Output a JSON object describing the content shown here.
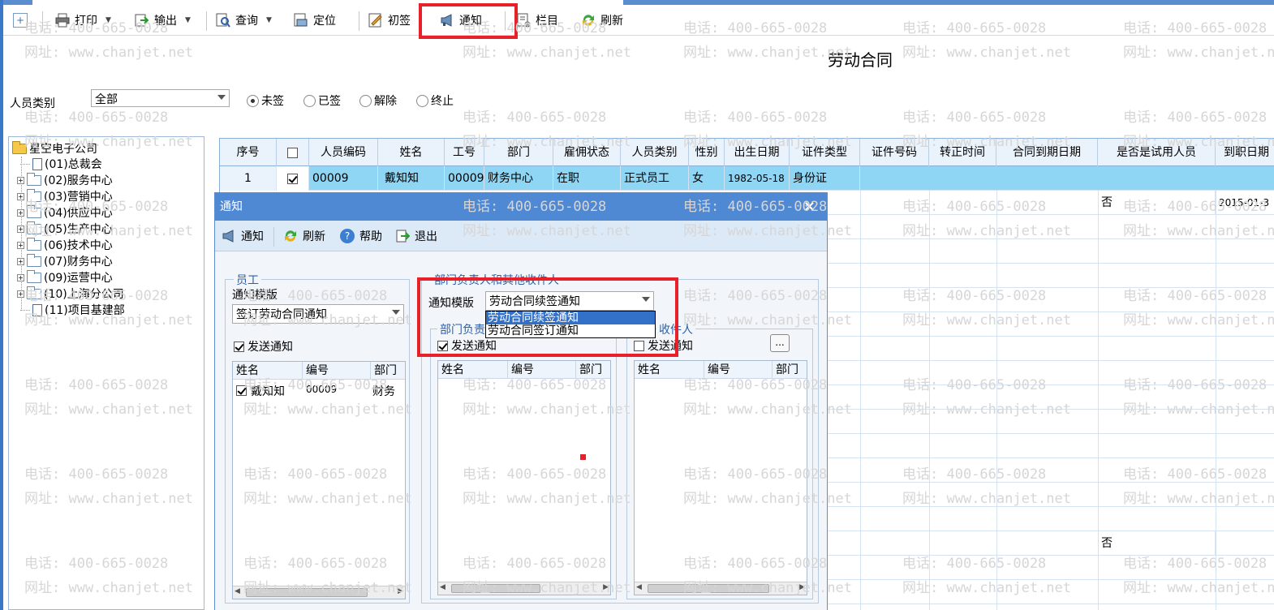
{
  "toolbar": {
    "print": "打印",
    "export": "输出",
    "query": "查询",
    "locate": "定位",
    "initial_sign": "初签",
    "notify": "通知",
    "columns": "栏目",
    "refresh": "刷新"
  },
  "page_title": "劳动合同",
  "filter": {
    "person_type_label": "人员类别",
    "person_type_value": "全部",
    "status_options": [
      "未签",
      "已签",
      "解除",
      "终止"
    ],
    "selected_status": "未签"
  },
  "tree": {
    "root": "星空电子公司",
    "children": [
      {
        "label": "(01)总裁会",
        "expandable": false
      },
      {
        "label": "(02)服务中心",
        "expandable": true
      },
      {
        "label": "(03)营销中心",
        "expandable": true
      },
      {
        "label": "(04)供应中心",
        "expandable": true
      },
      {
        "label": "(05)生产中心",
        "expandable": true
      },
      {
        "label": "(06)技术中心",
        "expandable": true
      },
      {
        "label": "(07)财务中心",
        "expandable": true
      },
      {
        "label": "(09)运营中心",
        "expandable": true
      },
      {
        "label": "(10)上海分公司",
        "expandable": true
      },
      {
        "label": "(11)项目基建部",
        "expandable": false
      }
    ]
  },
  "grid": {
    "columns": [
      "序号",
      "",
      "人员编码",
      "姓名",
      "工号",
      "部门",
      "雇佣状态",
      "人员类别",
      "性别",
      "出生日期",
      "证件类型",
      "证件号码",
      "转正时间",
      "合同到期日期",
      "是否是试用人员",
      "到职日期"
    ],
    "row1": {
      "seq": "1",
      "checked": true,
      "code": "00009",
      "name": "戴知知",
      "job_no": "00009",
      "dept": "财务中心",
      "employ_status": "在职",
      "person_type": "正式员工",
      "gender": "女",
      "birth_date": "1982-05-18",
      "id_type": "身份证"
    },
    "row2": {
      "trial": "否",
      "join_date": "2015-01-3"
    },
    "row_bottom": {
      "trial": "否"
    }
  },
  "dialog": {
    "title": "通知",
    "close": "×",
    "toolbar": {
      "notify": "通知",
      "refresh": "刷新",
      "help": "帮助",
      "exit": "退出"
    },
    "employee_group": {
      "title": "员工",
      "template_label": "通知模版",
      "template_value": "签订劳动合同通知",
      "send_label": "发送通知",
      "send_checked": true,
      "list_headers": [
        "姓名",
        "编号",
        "部门"
      ],
      "rows": [
        {
          "checked": true,
          "name": "戴知知",
          "code": "00009",
          "dept": "财务"
        }
      ]
    },
    "manager_group": {
      "title": "部门负责人和其他收件人",
      "template_label": "通知模版",
      "template_value": "劳动合同续签通知",
      "dropdown_options": [
        "劳动合同续签通知",
        "劳动合同签订通知"
      ],
      "dept_head_title": "部门负责",
      "dept_head_send_label": "发送通知",
      "dept_head_send_checked": true,
      "dept_head_headers": [
        "姓名",
        "编号",
        "部门"
      ],
      "other_title": "收件人",
      "other_send_label": "发送通知",
      "other_send_checked": false,
      "other_more": "...",
      "other_headers": [
        "姓名",
        "编号",
        "部门"
      ]
    }
  },
  "watermark": {
    "phone": "电话: 400-665-0028",
    "site": "网址: www.chanjet.net"
  },
  "colors": {
    "highlight_red": "#e8202a",
    "title_blue": "#4f89d4",
    "selected_row": "#8fd6f5",
    "dropdown_selected": "#3371c9"
  }
}
